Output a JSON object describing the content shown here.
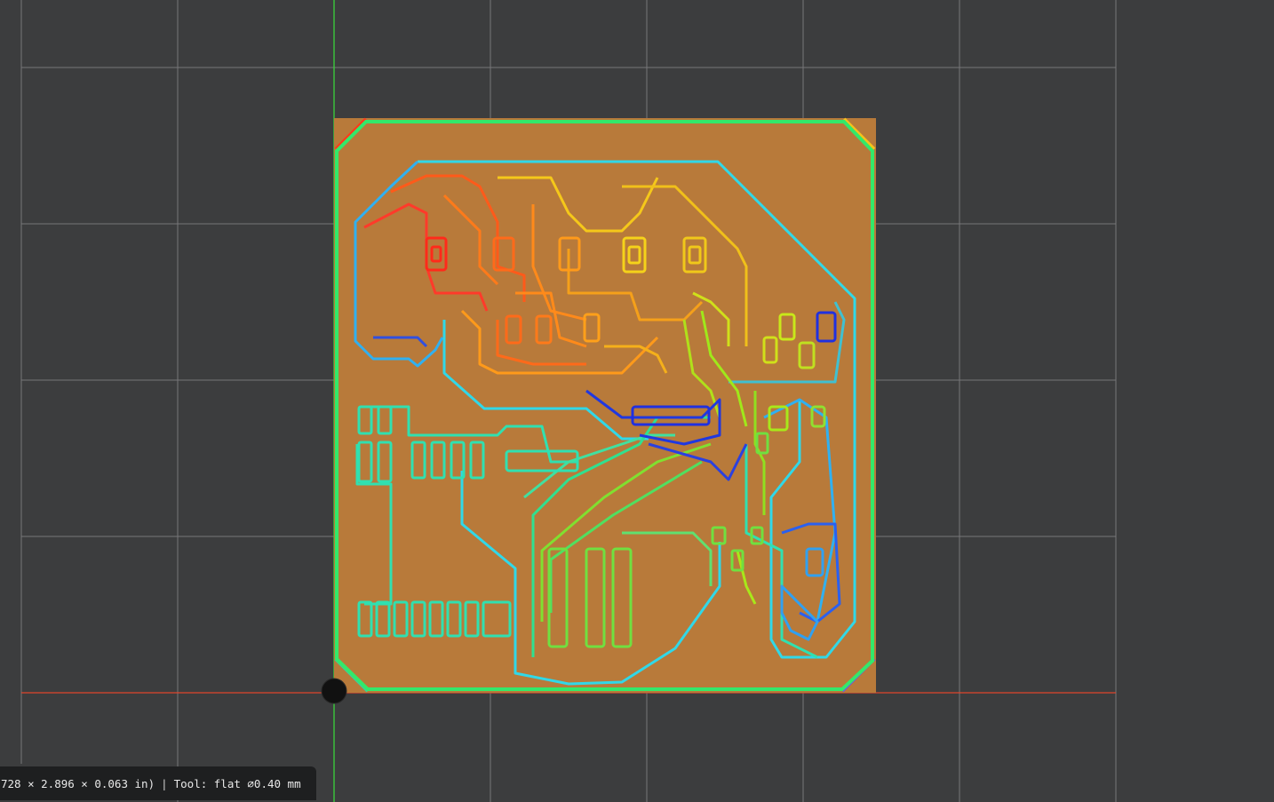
{
  "viewport": {
    "background": "#3c3d3e",
    "grid_color": "#8a8b8c",
    "x_axis_color": "#e0462c",
    "y_axis_color": "#3bd23b",
    "origin_marker": "black-dot"
  },
  "board": {
    "copper_color": "#b87a3a",
    "toolpath_palette": [
      "#ff2a1a",
      "#ff7a1a",
      "#f5d21a",
      "#a8f01a",
      "#30e070",
      "#30e0d0",
      "#30a0f0",
      "#2030e0"
    ]
  },
  "status": {
    "dimensions": "728 × 2.896 × 0.063 in)",
    "separator": "|",
    "tool": "Tool: flat ⌀0.40 mm"
  }
}
